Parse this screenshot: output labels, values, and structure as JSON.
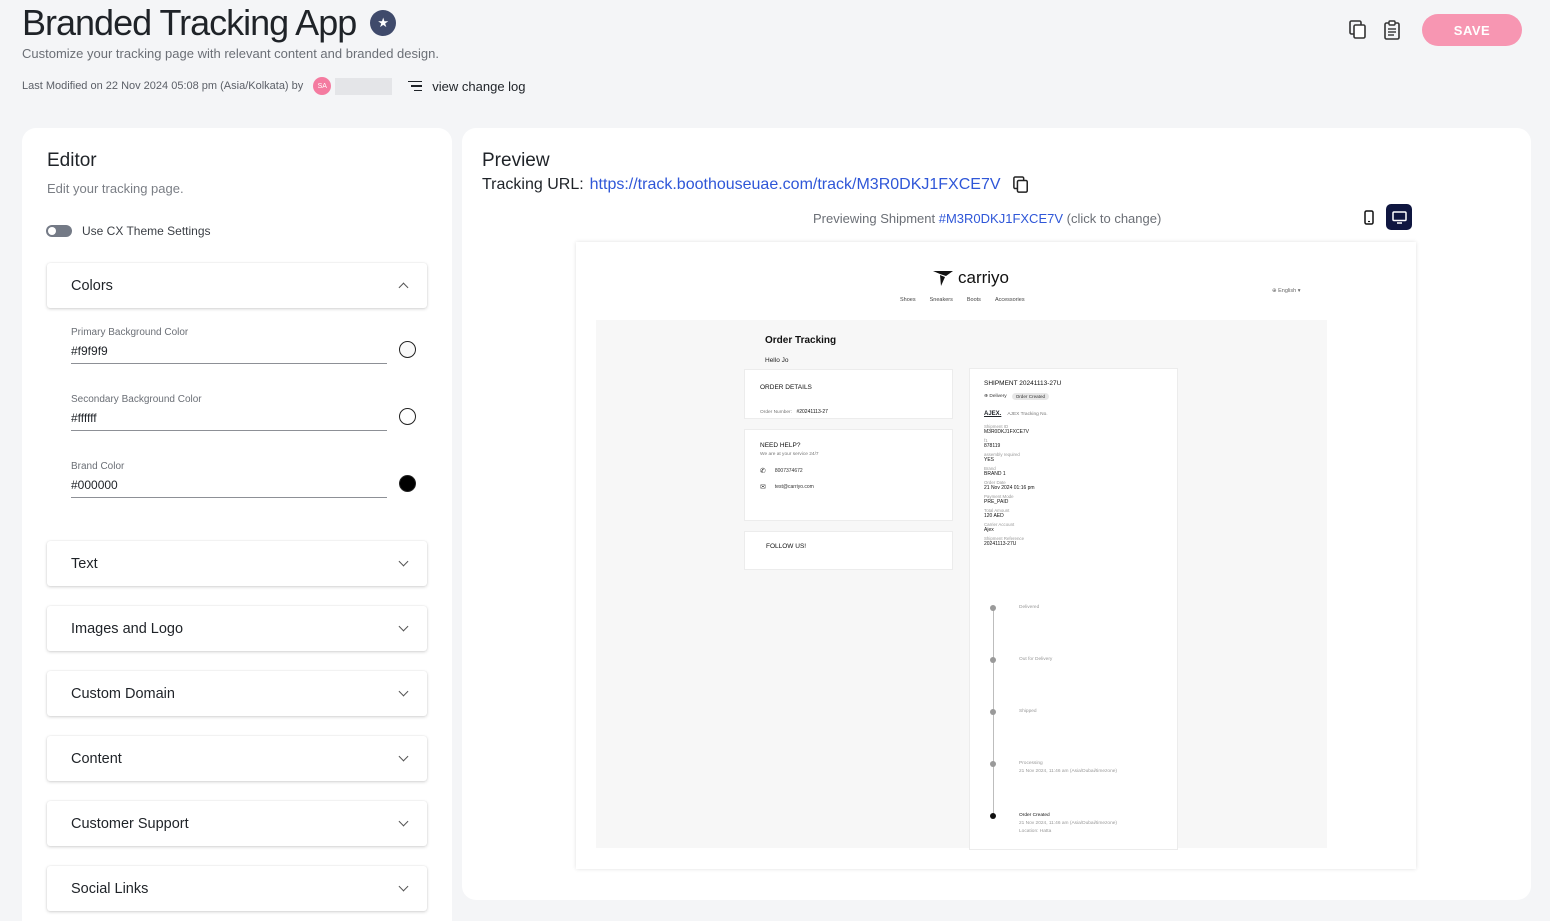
{
  "header": {
    "title": "Branded Tracking App",
    "subtitle": "Customize your tracking page with relevant content and branded design.",
    "modified_text": "Last Modified on 22 Nov 2024 05:08 pm (Asia/Kolkata) by",
    "avatar_initials": "SA",
    "changelog_label": "view change log",
    "save_label": "SAVE",
    "colors": {
      "save_bg": "#f796b2",
      "avatar_bg": "#f47ba0"
    }
  },
  "editor": {
    "title": "Editor",
    "subtitle": "Edit your tracking page.",
    "toggle_label": "Use CX Theme Settings",
    "colors_section": {
      "title": "Colors",
      "fields": [
        {
          "label": "Primary Background Color",
          "value": "#f9f9f9",
          "swatch": "#f9f9f9"
        },
        {
          "label": "Secondary Background Color",
          "value": "#ffffff",
          "swatch": "#ffffff"
        },
        {
          "label": "Brand Color",
          "value": "#000000",
          "swatch": "#000000"
        }
      ]
    },
    "sections": [
      "Text",
      "Images and Logo",
      "Custom Domain",
      "Content",
      "Customer Support",
      "Social Links"
    ]
  },
  "preview": {
    "title": "Preview",
    "url_label": "Tracking URL:",
    "url": "https://track.boothouseuae.com/track/M3R0DKJ1FXCE7V",
    "previewing_prefix": "Previewing Shipment",
    "previewing_id": "#M3R0DKJ1FXCE7V",
    "previewing_suffix": "(click to change)",
    "site": {
      "brand": "carriyo",
      "nav": [
        "Shoes",
        "Sneakers",
        "Boots",
        "Accessories"
      ],
      "language": "English",
      "page_title": "Order Tracking",
      "greeting": "Hello Jo",
      "order_details": {
        "title": "ORDER DETAILS",
        "number_label": "Order Number:",
        "number": "#20241113-27"
      },
      "help": {
        "title": "NEED HELP?",
        "subtitle": "We are at your service 24/7",
        "phone": "8007374672",
        "email": "test@carriyo.com"
      },
      "follow_title": "FOLLOW US!",
      "shipment": {
        "title": "SHIPMENT 20241113-27U",
        "delivery_label": "Delivery",
        "status_pill": "Order Created",
        "carrier_logo": "AJEX.",
        "carrier_tracking": "AJEX Tracking No.",
        "fields": [
          {
            "label": "Shipment ID",
            "value": "M3R0DKJ1FXCE7V"
          },
          {
            "label": "f1",
            "value": "878119"
          },
          {
            "label": "assembly required",
            "value": "YES"
          },
          {
            "label": "Brand",
            "value": "BRAND 1"
          },
          {
            "label": "Order Date",
            "value": "21 Nov 2024 01:16 pm"
          },
          {
            "label": "Payment Mode",
            "value": "PRE_PAID"
          },
          {
            "label": "Total Amount",
            "value": "120 AED"
          },
          {
            "label": "Carrier Account",
            "value": "Ajex"
          },
          {
            "label": "Shipment Reference",
            "value": "20241113-27U"
          }
        ],
        "timeline": [
          {
            "status": "Delivered",
            "detail": "",
            "location": ""
          },
          {
            "status": "Out for Delivery",
            "detail": "",
            "location": ""
          },
          {
            "status": "Shipped",
            "detail": "",
            "location": ""
          },
          {
            "status": "Processing",
            "detail": "21 Nov 2024, 11:46 am (Asia/Dubai/timezone)",
            "location": ""
          },
          {
            "status": "Order Created",
            "detail": "21 Nov 2024, 11:46 am (Asia/Dubai/timezone)",
            "location": "Location: Hatta"
          }
        ]
      }
    }
  }
}
